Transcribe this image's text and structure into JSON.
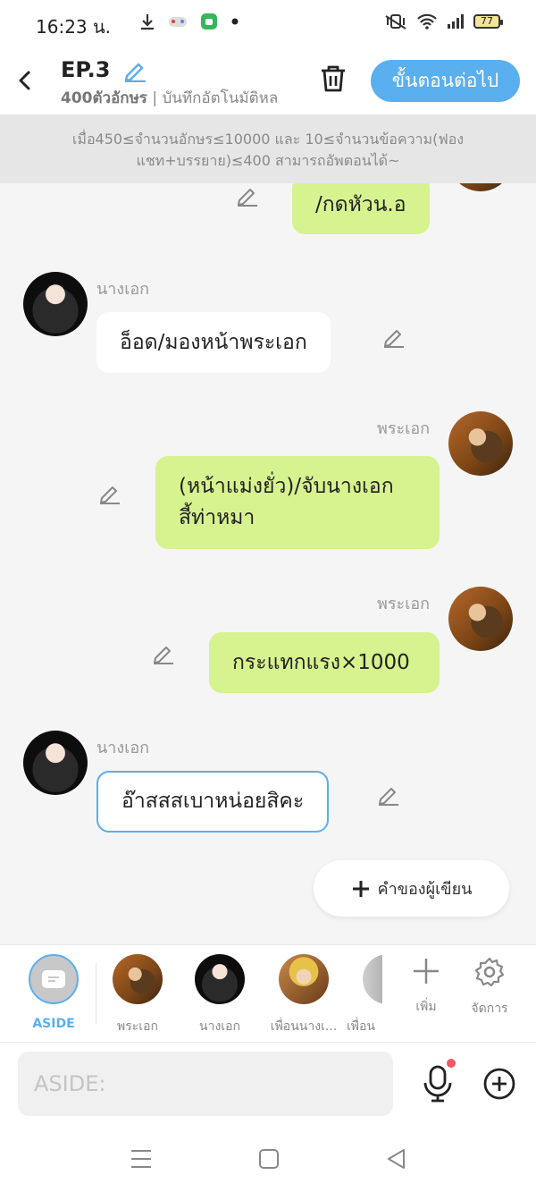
{
  "status_bar": {
    "time": "16:23 น.",
    "battery": "77"
  },
  "header": {
    "episode_title": "EP.3",
    "char_count": "400ตัวอักษร",
    "autosave_text": " | บันทึกอัตโนมัติหล",
    "next_button": "ขั้นตอนต่อไป"
  },
  "notice": {
    "line1": "เมื่อ450≤จำนวนอักษร≤10000 และ 10≤จำนวนข้อความ(ฟอง",
    "line2": "แชท+บรรยาย)≤400 สามารถอัพตอนได้~"
  },
  "messages": [
    {
      "speaker": "",
      "text": "/กดหัวน.อ",
      "side": "right"
    },
    {
      "speaker": "นางเอก",
      "text": "อ็อด/มองหน้าพระเอก",
      "side": "left"
    },
    {
      "speaker": "พระเอก",
      "text_line1": "(หน้าแม่งยั่ว)/จับนางเอก",
      "text_line2": "สี้ท่าหมา",
      "side": "right"
    },
    {
      "speaker": "พระเอก",
      "text": "กระแทกแรง×1000",
      "side": "right"
    },
    {
      "speaker": "นางเอก",
      "text": "อ๊าสสสเบาหน่อยสิคะ",
      "side": "left"
    }
  ],
  "author_note_button": "คำของผู้เขียน",
  "characters": [
    {
      "label": "ASIDE"
    },
    {
      "label": "พระเอก"
    },
    {
      "label": "นางเอก"
    },
    {
      "label": "เพื่อนนางเ..."
    },
    {
      "label": "เพื่อน"
    }
  ],
  "tools": {
    "add": "เพิ่ม",
    "manage": "จัดการ"
  },
  "input": {
    "placeholder": "ASIDE:"
  },
  "colors": {
    "accent": "#5aafef",
    "bubble_green": "#d7f38f",
    "mic_dot": "#ef5864"
  }
}
